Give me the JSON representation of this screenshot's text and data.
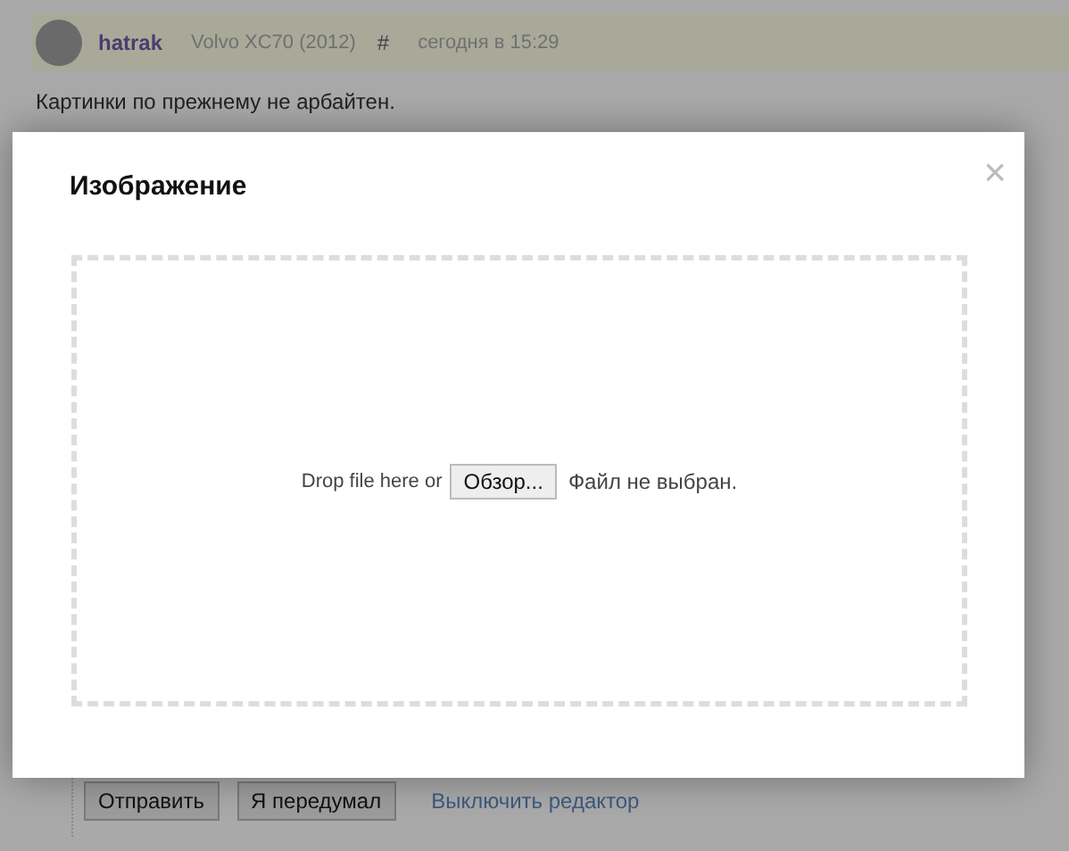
{
  "post": {
    "author": "hatrak",
    "car": "Volvo XC70 (2012)",
    "anchor": "#",
    "time": "сегодня в 15:29",
    "text": "Картинки по прежнему не арбайтен."
  },
  "editor_actions": {
    "submit": "Отправить",
    "cancel": "Я передумал",
    "disable_link": "Выключить редактор"
  },
  "dialog": {
    "title": "Изображение",
    "close": "×",
    "drop_text": "Drop file here or",
    "browse_button": "Обзор...",
    "file_status": "Файл не выбран."
  }
}
